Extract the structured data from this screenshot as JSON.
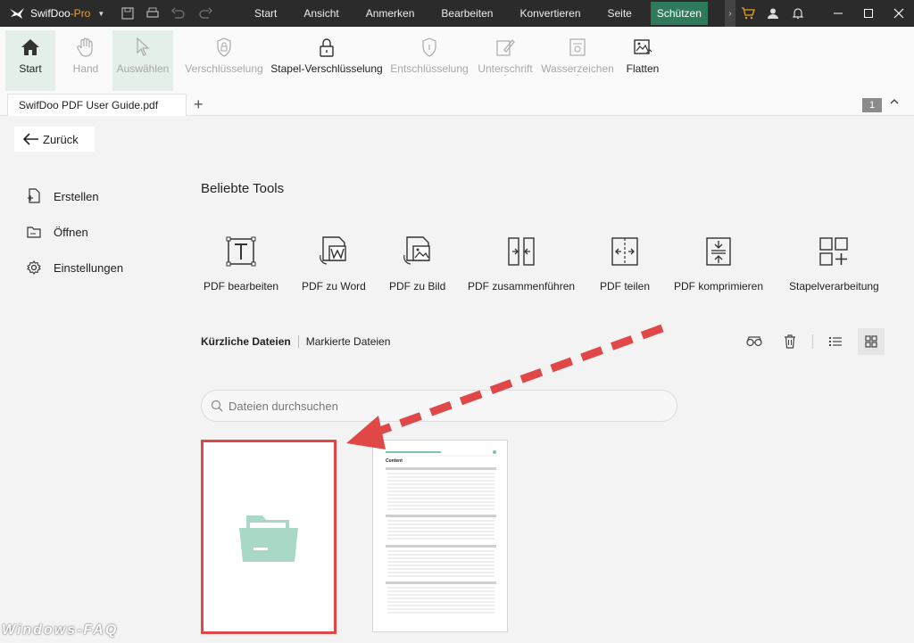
{
  "titlebar": {
    "app_name": "SwifDoo",
    "app_edition": "-Pro",
    "menu": [
      "Start",
      "Ansicht",
      "Anmerken",
      "Bearbeiten",
      "Konvertieren",
      "Seite",
      "Schützen"
    ],
    "active_menu": "Schützen",
    "icons": [
      "save-icon",
      "print-icon",
      "undo-icon",
      "redo-icon",
      "cart-icon",
      "user-icon",
      "bell-icon"
    ],
    "accent_color": "#2f7a5a"
  },
  "ribbon": {
    "start": "Start",
    "hand": "Hand",
    "select": "Auswählen",
    "encrypt": "Verschlüsselung",
    "batch_encrypt": "Stapel-Verschlüsselung",
    "decrypt": "Entschlüsselung",
    "signature": "Unterschrift",
    "watermark": "Wasserzeichen",
    "flatten": "Flatten"
  },
  "tabs": {
    "doc_tab": "SwifDoo PDF User Guide.pdf",
    "add_tab": "+",
    "page_badge": "1"
  },
  "main": {
    "back": "Zurück",
    "sidebar": [
      {
        "label": "Erstellen",
        "icon": "create-icon"
      },
      {
        "label": "Öffnen",
        "icon": "open-folder-icon"
      },
      {
        "label": "Einstellungen",
        "icon": "settings-gear-icon"
      }
    ],
    "popular_title": "Beliebte Tools",
    "tools": [
      "PDF bearbeiten",
      "PDF zu Word",
      "PDF zu Bild",
      "PDF zusammenführen",
      "PDF teilen",
      "PDF komprimieren",
      "Stapelverarbeitung"
    ],
    "recent_tab": "Kürzliche Dateien",
    "marked_tab": "Markierte Dateien",
    "search_placeholder": "Dateien durchsuchen",
    "doc_preview_title": "Content",
    "highlight_color": "#e04848"
  },
  "watermark_text": "Windows-FAQ"
}
